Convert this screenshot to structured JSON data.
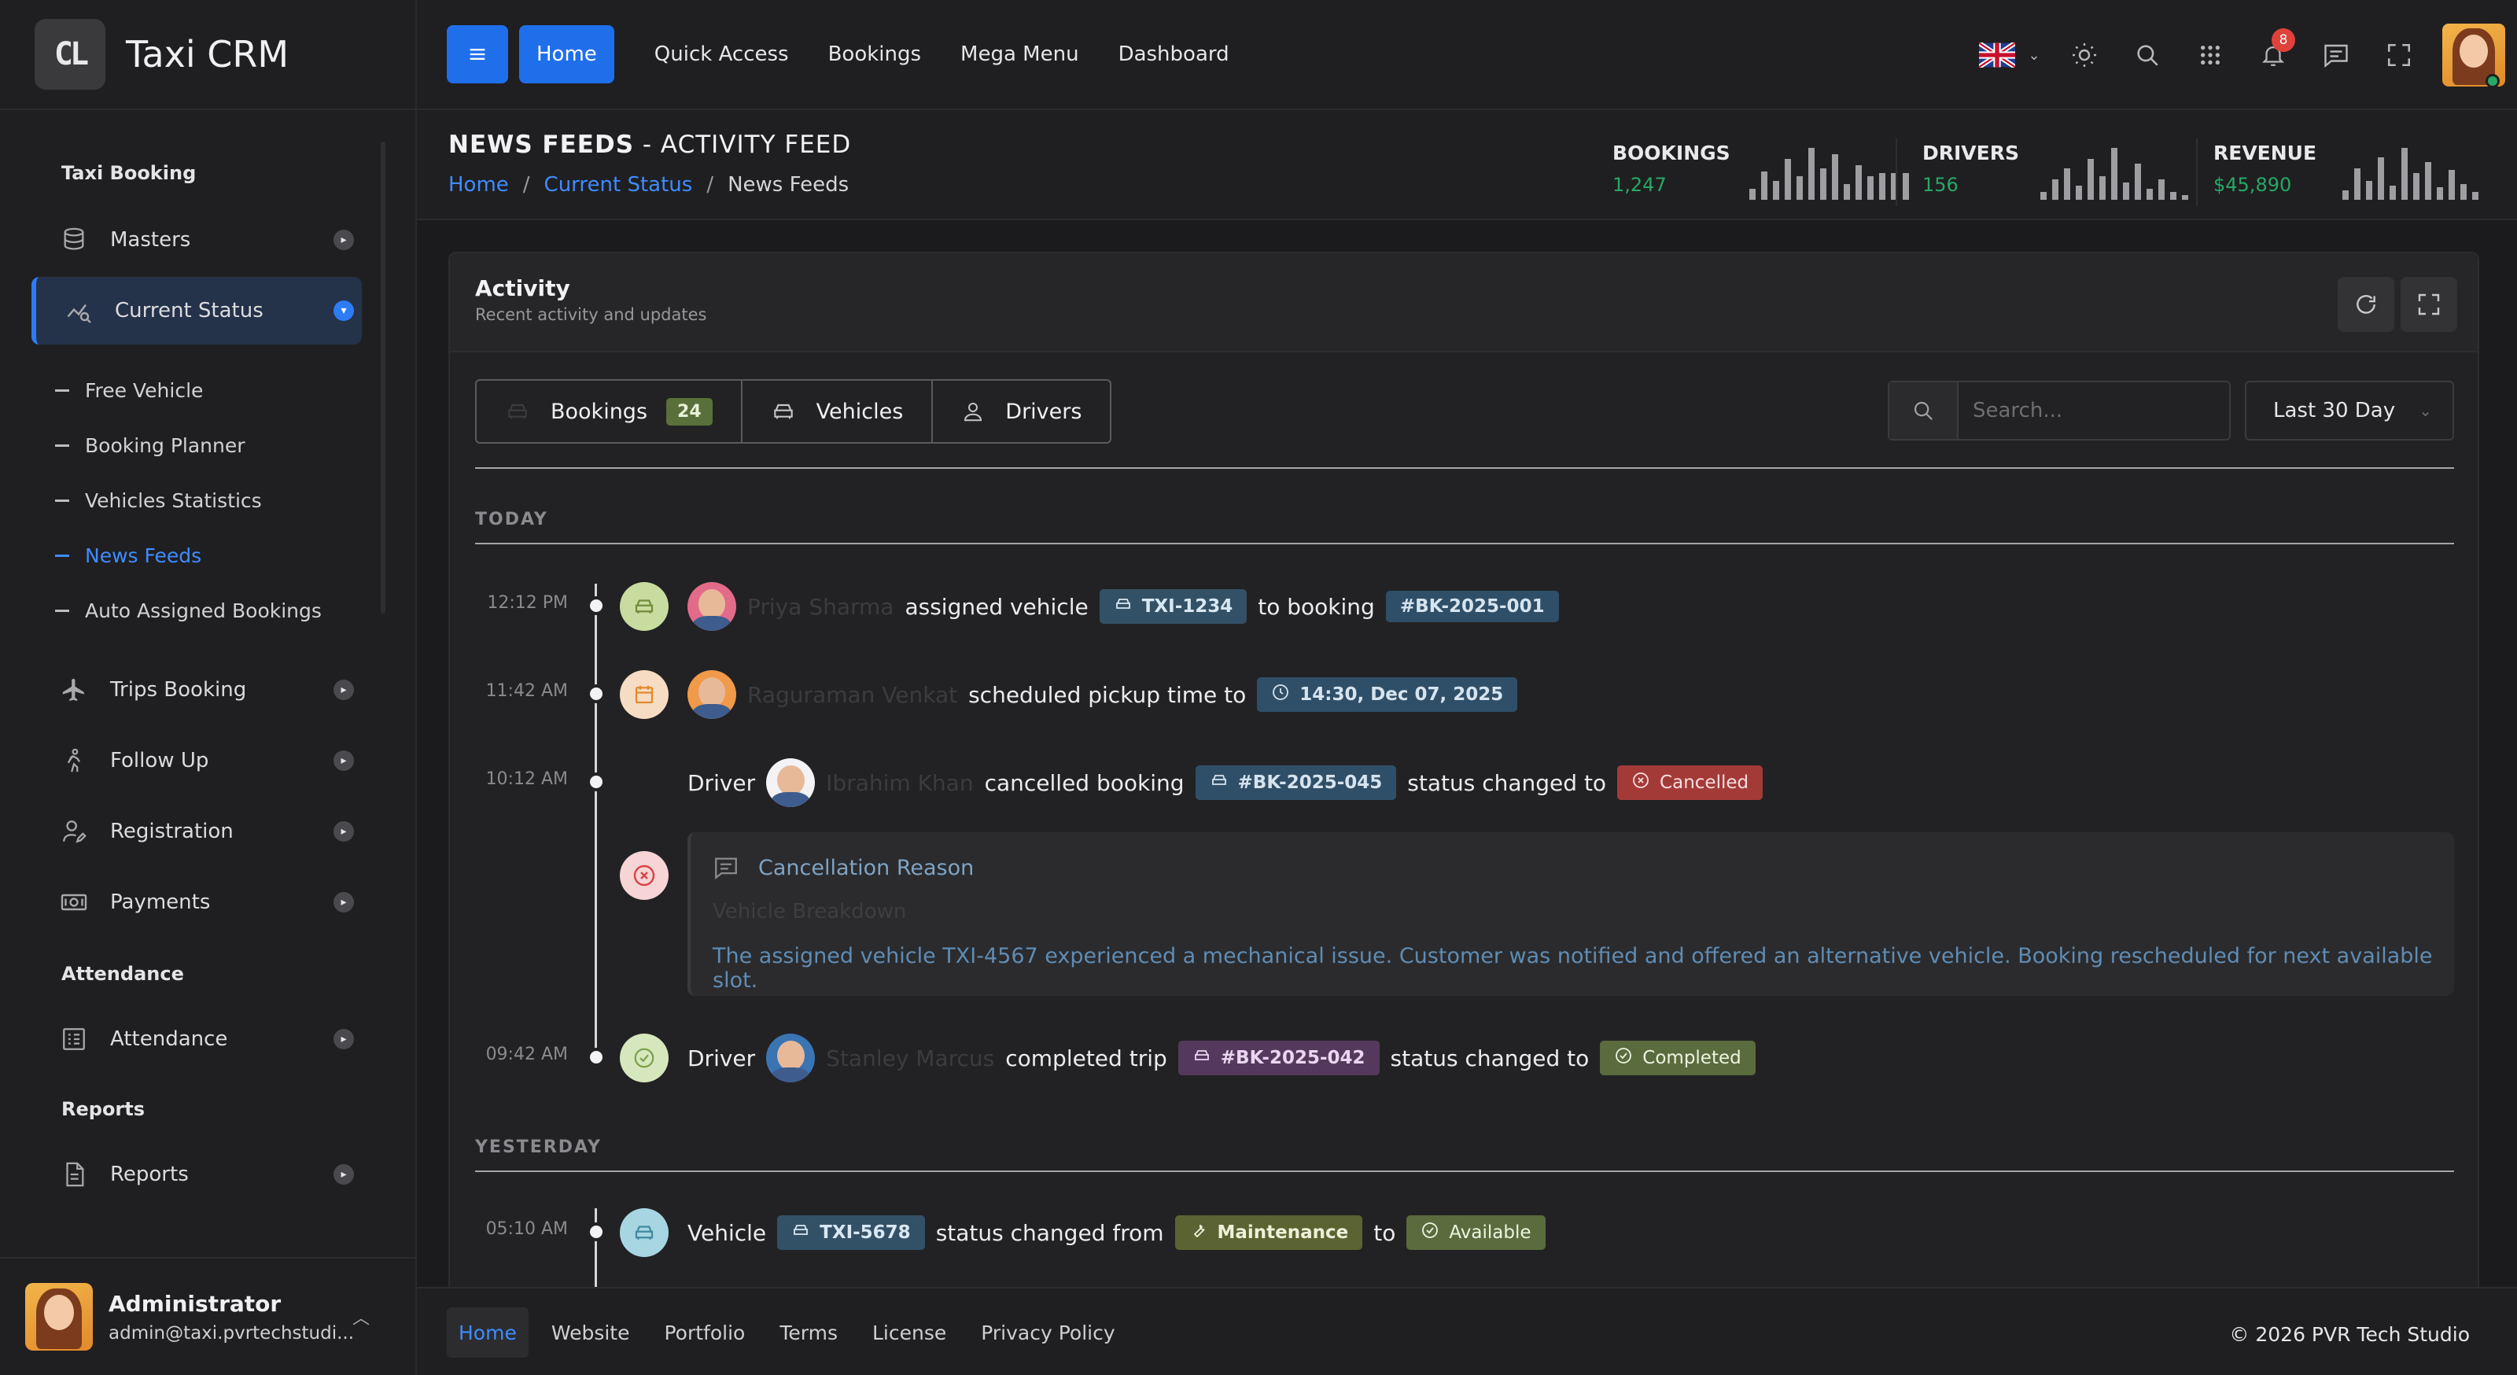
{
  "app": {
    "logo_text": "CL",
    "name": "Taxi CRM"
  },
  "sidebar": {
    "sections": {
      "taxi_booking": "Taxi Booking",
      "attendance": "Attendance",
      "reports": "Reports"
    },
    "items": {
      "masters": "Masters",
      "current_status": "Current Status",
      "trips_booking": "Trips Booking",
      "follow_up": "Follow Up",
      "registration": "Registration",
      "payments": "Payments",
      "attendance": "Attendance",
      "reports": "Reports"
    },
    "sub_items": [
      "Free Vehicle",
      "Booking Planner",
      "Vehicles Statistics",
      "News Feeds",
      "Auto Assigned Bookings"
    ],
    "user": {
      "name": "Administrator",
      "email": "admin@taxi.pvrtechstudi..."
    }
  },
  "header": {
    "nav": [
      "Home",
      "Quick Access",
      "Bookings",
      "Mega Menu",
      "Dashboard"
    ],
    "notification_count": "8"
  },
  "page": {
    "title_bold": "NEWS FEEDS",
    "title_rest": " - ACTIVITY FEED",
    "breadcrumb": [
      "Home",
      "Current Status",
      "News Feeds"
    ],
    "stats": [
      {
        "label": "BOOKINGS",
        "value": "1,247"
      },
      {
        "label": "DRIVERS",
        "value": "156"
      },
      {
        "label": "REVENUE",
        "value": "$45,890"
      }
    ]
  },
  "activity": {
    "title": "Activity",
    "subtitle": "Recent activity and updates",
    "tabs": {
      "bookings": "Bookings",
      "bookings_count": "24",
      "vehicles": "Vehicles",
      "drivers": "Drivers"
    },
    "search_placeholder": "Search...",
    "range": "Last 30 Day",
    "groups": {
      "today": "TODAY",
      "yesterday": "YESTERDAY"
    },
    "events": [
      {
        "time": "12:12 PM",
        "actor": "Priya Sharma",
        "text1": "assigned vehicle",
        "vehicle": "TXI-1234",
        "text2": "to booking",
        "booking": "#BK-2025-001"
      },
      {
        "time": "11:42 AM",
        "actor": "Raguraman Venkat",
        "text1": "scheduled pickup time to",
        "datetime": "14:30, Dec 07, 2025"
      },
      {
        "time": "10:12 AM",
        "prefix": "Driver",
        "actor": "Ibrahim Khan",
        "text1": "cancelled booking",
        "booking": "#BK-2025-045",
        "text2": "status changed to",
        "status": "Cancelled"
      },
      {
        "time": "09:42 AM",
        "prefix": "Driver",
        "actor": "Stanley Marcus",
        "text1": "completed trip",
        "booking": "#BK-2025-042",
        "text2": "status changed to",
        "status": "Completed"
      },
      {
        "time": "05:10 AM",
        "prefix": "Vehicle",
        "vehicle": "TXI-5678",
        "text1": "status changed from",
        "from": "Maintenance",
        "text2": "to",
        "to": "Available"
      }
    ],
    "cancellation": {
      "title": "Cancellation Reason",
      "reason": "Vehicle Breakdown",
      "text": "The assigned vehicle TXI-4567 experienced a mechanical issue. Customer was notified and offered an alternative vehicle. Booking rescheduled for next available slot."
    }
  },
  "footer": {
    "links": [
      "Home",
      "Website",
      "Portfolio",
      "Terms",
      "License",
      "Privacy Policy"
    ],
    "copyright": "© 2026  PVR Tech Studio"
  },
  "colors": {
    "accent": "#1f6feb",
    "positive": "#27a865",
    "danger": "#a33a38"
  }
}
